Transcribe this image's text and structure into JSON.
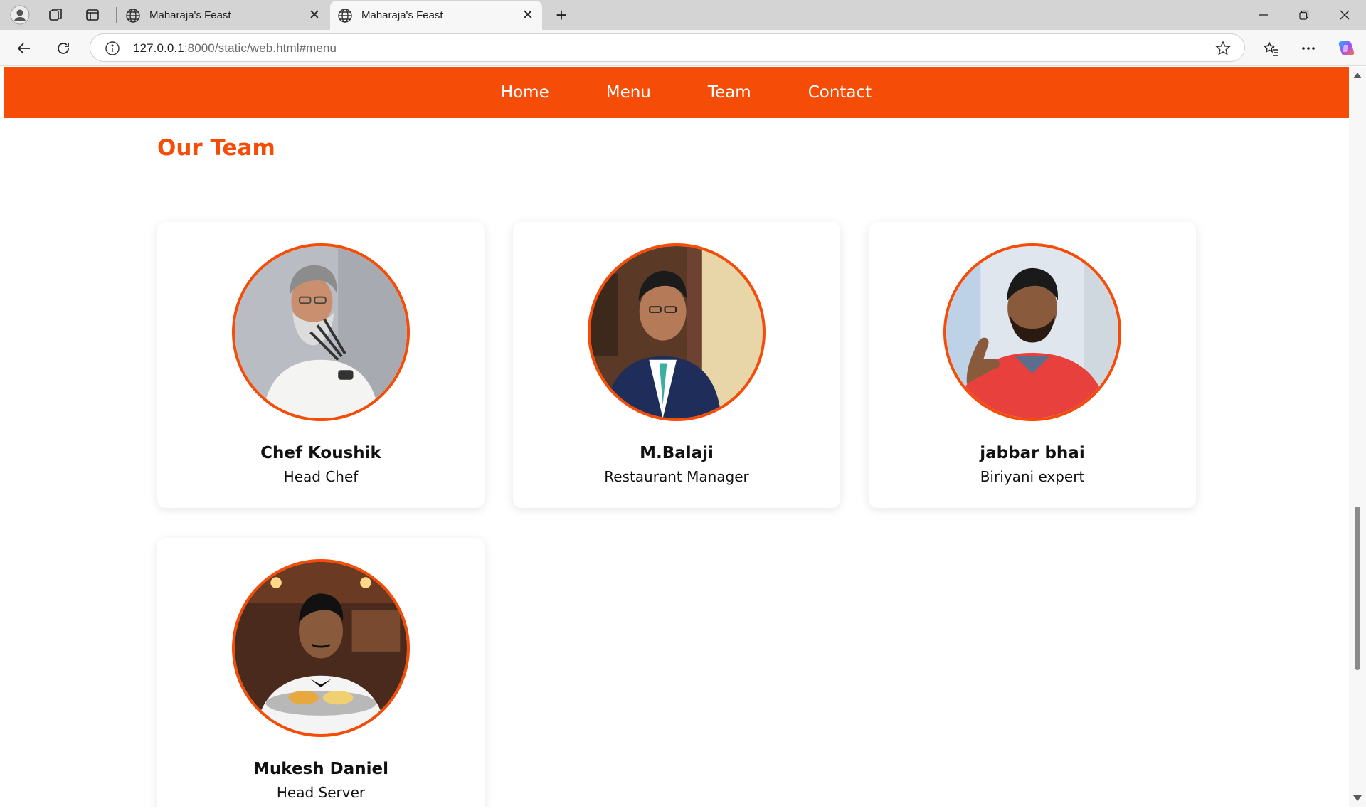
{
  "browser": {
    "tabs": [
      {
        "title": "Maharaja's Feast",
        "active": false
      },
      {
        "title": "Maharaja's Feast",
        "active": true
      }
    ],
    "url_host": "127.0.0.1",
    "url_rest": ":8000/static/web.html#menu"
  },
  "site": {
    "nav": [
      "Home",
      "Menu",
      "Team",
      "Contact"
    ],
    "section_title": "Our Team",
    "team": [
      {
        "name": "Chef Koushik",
        "role": "Head Chef"
      },
      {
        "name": "M.Balaji",
        "role": "Restaurant Manager"
      },
      {
        "name": "jabbar bhai",
        "role": "Biriyani expert"
      },
      {
        "name": "Mukesh Daniel",
        "role": "Head Server"
      }
    ]
  },
  "colors": {
    "brand": "#f54c07",
    "tabbar": "#d4d4d4"
  }
}
